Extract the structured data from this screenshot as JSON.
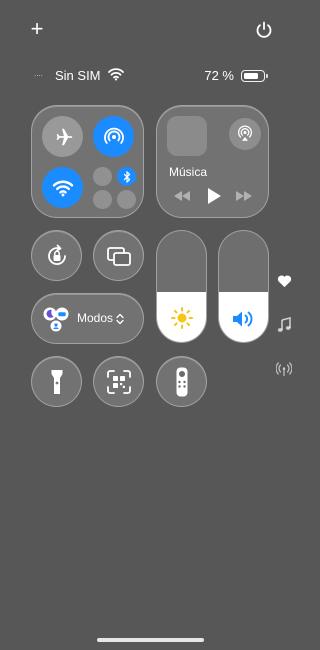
{
  "top": {
    "add_icon": "plus-icon",
    "power_icon": "power-icon"
  },
  "status_bar": {
    "signal": "....",
    "carrier": "Sin SIM",
    "battery_percent": "72 %",
    "battery_level": 0.72
  },
  "connectivity": {
    "airplane_mode": false,
    "airdrop_on": true,
    "wifi_on": true,
    "bluetooth_on": true
  },
  "media": {
    "title": "Música",
    "icons": [
      "airplay-icon",
      "rewind-icon",
      "play-icon",
      "fast-forward-icon"
    ]
  },
  "sliders": {
    "brightness_level": 0.45,
    "volume_level": 0.45
  },
  "modes": {
    "label": "Modos",
    "chevron": "⌃⌄"
  },
  "side_icons": [
    "heart-icon",
    "music-note-icon",
    "antenna-icon"
  ],
  "colors": {
    "accent": "#1a8cff",
    "background": "#575757",
    "sun": "#f5c518"
  }
}
